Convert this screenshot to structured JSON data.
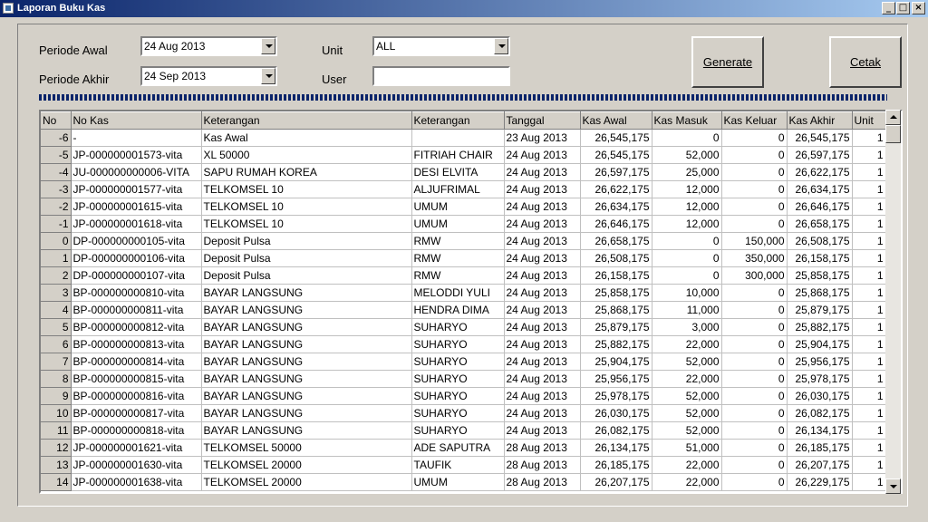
{
  "window": {
    "title": "Laporan Buku Kas",
    "minimize": "_",
    "maximize": "□",
    "close": "×"
  },
  "filters": {
    "periode_awal_label": "Periode Awal",
    "periode_awal_value": "24 Aug 2013",
    "periode_akhir_label": "Periode Akhir",
    "periode_akhir_value": "24 Sep 2013",
    "unit_label": "Unit",
    "unit_value": "ALL",
    "user_label": "User",
    "user_value": ""
  },
  "buttons": {
    "generate": "Generate",
    "cetak": "Cetak"
  },
  "table": {
    "columns": [
      "No",
      "No Kas",
      "Keterangan",
      "Keterangan",
      "Tanggal",
      "Kas Awal",
      "Kas Masuk",
      "Kas Keluar",
      "Kas Akhir",
      "Unit"
    ],
    "rows": [
      [
        "-6",
        "-",
        "Kas Awal",
        "",
        "23 Aug 2013",
        "26,545,175",
        "0",
        "0",
        "26,545,175",
        "1"
      ],
      [
        "-5",
        "JP-000000001573-vita",
        "XL 50000",
        "FITRIAH CHAIR",
        "24 Aug 2013",
        "26,545,175",
        "52,000",
        "0",
        "26,597,175",
        "1"
      ],
      [
        "-4",
        "JU-000000000006-VITA",
        "SAPU RUMAH KOREA",
        "DESI ELVITA",
        "24 Aug 2013",
        "26,597,175",
        "25,000",
        "0",
        "26,622,175",
        "1"
      ],
      [
        "-3",
        "JP-000000001577-vita",
        "TELKOMSEL 10",
        "ALJUFRIMAL",
        "24 Aug 2013",
        "26,622,175",
        "12,000",
        "0",
        "26,634,175",
        "1"
      ],
      [
        "-2",
        "JP-000000001615-vita",
        "TELKOMSEL 10",
        "UMUM",
        "24 Aug 2013",
        "26,634,175",
        "12,000",
        "0",
        "26,646,175",
        "1"
      ],
      [
        "-1",
        "JP-000000001618-vita",
        "TELKOMSEL 10",
        "UMUM",
        "24 Aug 2013",
        "26,646,175",
        "12,000",
        "0",
        "26,658,175",
        "1"
      ],
      [
        "0",
        "DP-000000000105-vita",
        "Deposit Pulsa",
        "RMW",
        "24 Aug 2013",
        "26,658,175",
        "0",
        "150,000",
        "26,508,175",
        "1"
      ],
      [
        "1",
        "DP-000000000106-vita",
        "Deposit Pulsa",
        "RMW",
        "24 Aug 2013",
        "26,508,175",
        "0",
        "350,000",
        "26,158,175",
        "1"
      ],
      [
        "2",
        "DP-000000000107-vita",
        "Deposit Pulsa",
        "RMW",
        "24 Aug 2013",
        "26,158,175",
        "0",
        "300,000",
        "25,858,175",
        "1"
      ],
      [
        "3",
        "BP-000000000810-vita",
        "BAYAR LANGSUNG",
        "MELODDI YULI",
        "24 Aug 2013",
        "25,858,175",
        "10,000",
        "0",
        "25,868,175",
        "1"
      ],
      [
        "4",
        "BP-000000000811-vita",
        "BAYAR LANGSUNG",
        "HENDRA DIMA",
        "24 Aug 2013",
        "25,868,175",
        "11,000",
        "0",
        "25,879,175",
        "1"
      ],
      [
        "5",
        "BP-000000000812-vita",
        "BAYAR LANGSUNG",
        "SUHARYO",
        "24 Aug 2013",
        "25,879,175",
        "3,000",
        "0",
        "25,882,175",
        "1"
      ],
      [
        "6",
        "BP-000000000813-vita",
        "BAYAR LANGSUNG",
        "SUHARYO",
        "24 Aug 2013",
        "25,882,175",
        "22,000",
        "0",
        "25,904,175",
        "1"
      ],
      [
        "7",
        "BP-000000000814-vita",
        "BAYAR LANGSUNG",
        "SUHARYO",
        "24 Aug 2013",
        "25,904,175",
        "52,000",
        "0",
        "25,956,175",
        "1"
      ],
      [
        "8",
        "BP-000000000815-vita",
        "BAYAR LANGSUNG",
        "SUHARYO",
        "24 Aug 2013",
        "25,956,175",
        "22,000",
        "0",
        "25,978,175",
        "1"
      ],
      [
        "9",
        "BP-000000000816-vita",
        "BAYAR LANGSUNG",
        "SUHARYO",
        "24 Aug 2013",
        "25,978,175",
        "52,000",
        "0",
        "26,030,175",
        "1"
      ],
      [
        "10",
        "BP-000000000817-vita",
        "BAYAR LANGSUNG",
        "SUHARYO",
        "24 Aug 2013",
        "26,030,175",
        "52,000",
        "0",
        "26,082,175",
        "1"
      ],
      [
        "11",
        "BP-000000000818-vita",
        "BAYAR LANGSUNG",
        "SUHARYO",
        "24 Aug 2013",
        "26,082,175",
        "52,000",
        "0",
        "26,134,175",
        "1"
      ],
      [
        "12",
        "JP-000000001621-vita",
        "TELKOMSEL 50000",
        "ADE SAPUTRA",
        "28 Aug 2013",
        "26,134,175",
        "51,000",
        "0",
        "26,185,175",
        "1"
      ],
      [
        "13",
        "JP-000000001630-vita",
        "TELKOMSEL 20000",
        "TAUFIK",
        "28 Aug 2013",
        "26,185,175",
        "22,000",
        "0",
        "26,207,175",
        "1"
      ],
      [
        "14",
        "JP-000000001638-vita",
        "TELKOMSEL 20000",
        "UMUM",
        "28 Aug 2013",
        "26,207,175",
        "22,000",
        "0",
        "26,229,175",
        "1"
      ]
    ]
  }
}
